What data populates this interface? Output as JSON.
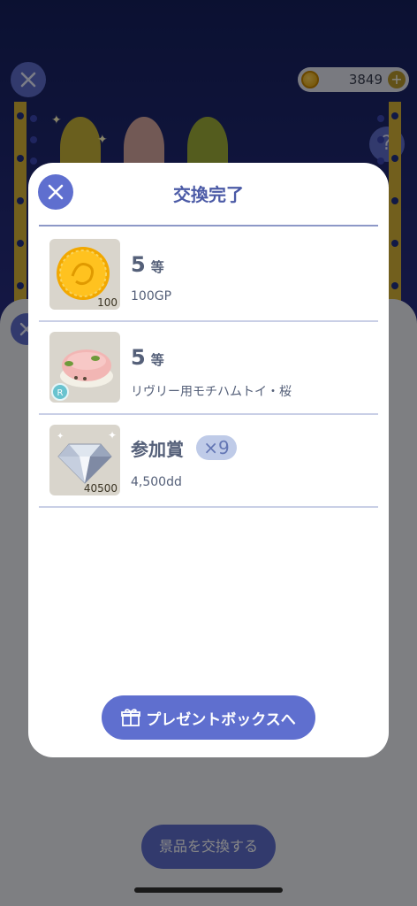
{
  "header": {
    "close_icon": "close-icon",
    "coin_balance": "3849",
    "plus_label": "+",
    "help_label": "?"
  },
  "background": {
    "exchange_button_label": "景品を交換する"
  },
  "modal": {
    "title": "交換完了",
    "prizes": [
      {
        "rank": "5",
        "rank_suffix": "等",
        "description": "100GP",
        "thumb_qty": "100",
        "icon": "gold-coin-icon"
      },
      {
        "rank": "5",
        "rank_suffix": "等",
        "description": "リヴリー用モチハムトイ・桜",
        "rarity": "R",
        "icon": "mochi-hamster-toy-icon"
      },
      {
        "rank": "参加賞",
        "multiplier": "×9",
        "description": "4,500dd",
        "thumb_qty": "40500",
        "icon": "diamond-icon"
      }
    ],
    "present_box_button_label": "プレゼントボックスへ",
    "present_box_icon": "gift-icon"
  },
  "colors": {
    "accent": "#5f6fcf",
    "title": "#4b5aa6",
    "text": "#556079",
    "pillar": "#d7b437",
    "bg_dark": "#1d2466"
  }
}
